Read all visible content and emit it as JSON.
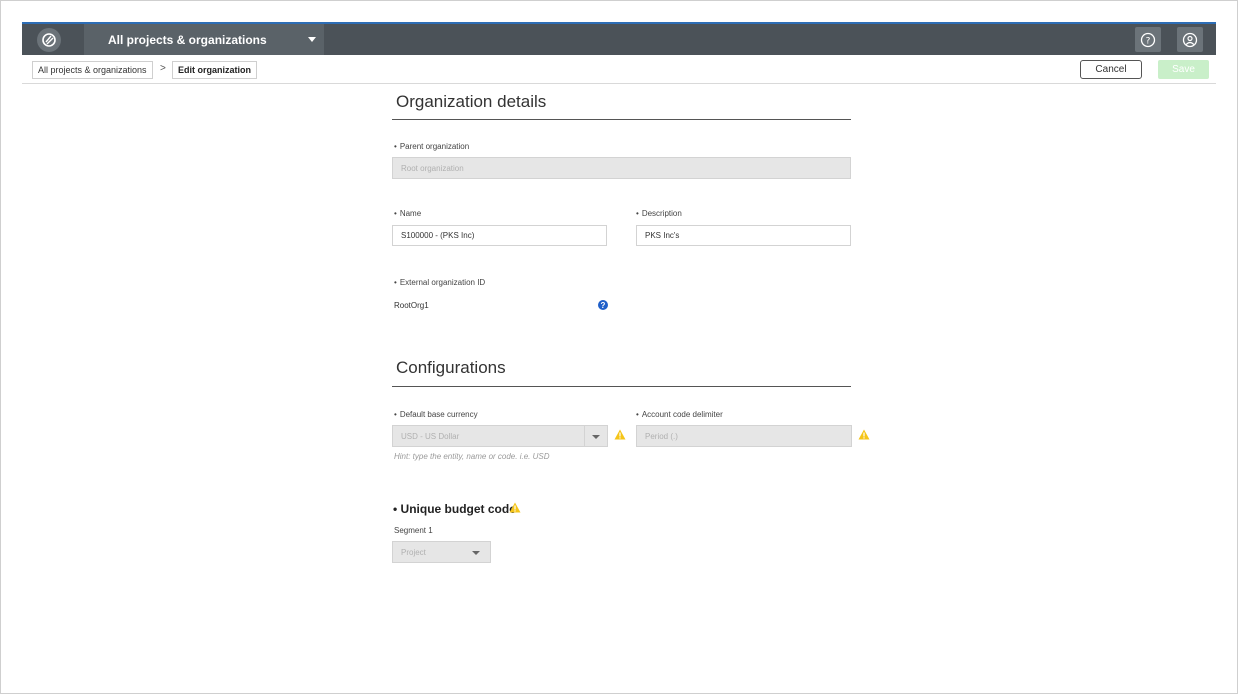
{
  "header": {
    "project_selector": "All projects & organizations"
  },
  "breadcrumb": {
    "root": "All projects & organizations",
    "separator": ">",
    "current": "Edit organization"
  },
  "actions": {
    "cancel": "Cancel",
    "save": "Save"
  },
  "org_details": {
    "title": "Organization details",
    "parent_label": "Parent organization",
    "parent_value": "Root organization",
    "name_label": "Name",
    "name_value": "S100000 - (PKS Inc)",
    "description_label": "Description",
    "description_value": "PKS Inc's",
    "external_id_label": "External organization ID",
    "external_id_value": "RootOrg1"
  },
  "configurations": {
    "title": "Configurations",
    "currency_label": "Default base currency",
    "currency_value": "USD - US Dollar",
    "currency_hint": "Hint: type the entity, name or code. i.e. USD",
    "delimiter_label": "Account code delimiter",
    "delimiter_value": "Period (.)",
    "budget_code_title": "Unique budget code",
    "segment_label": "Segment 1",
    "segment_value": "Project"
  },
  "colors": {
    "topbar": "#4b5258",
    "accent": "#2d6db5",
    "warning": "#f5c518",
    "help": "#1f5fc9",
    "save_disabled": "#c9efc9"
  },
  "icons": {
    "logo": "app-logo-icon",
    "help": "question-circle-icon",
    "user": "user-circle-icon",
    "warning": "warning-triangle-icon"
  }
}
